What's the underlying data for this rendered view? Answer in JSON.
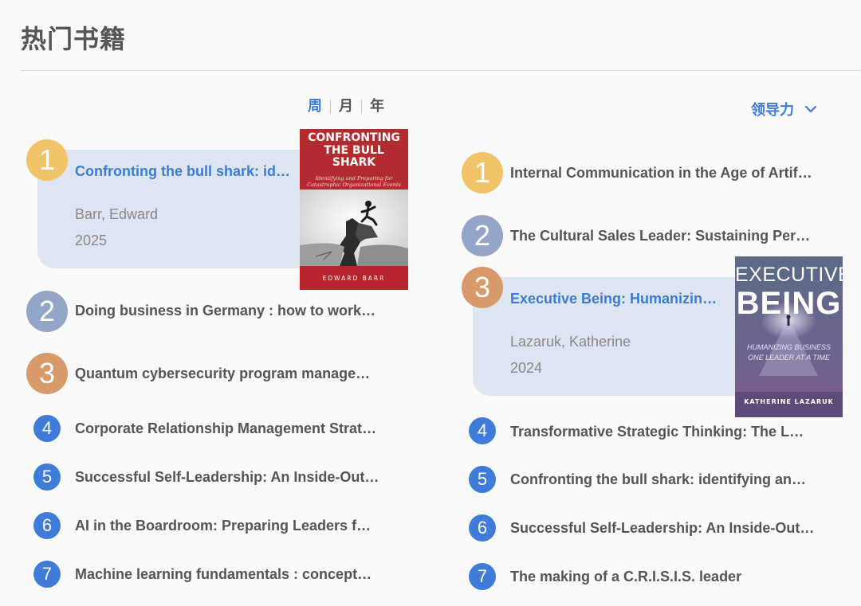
{
  "page": {
    "title": "热门书籍"
  },
  "period_tabs": [
    {
      "label": "周",
      "active": true
    },
    {
      "label": "月",
      "active": false
    },
    {
      "label": "年",
      "active": false
    }
  ],
  "category": {
    "label": "领导力",
    "icon": "chevron-down-icon"
  },
  "colors": {
    "accent": "#3d7bd6",
    "rank_gold": "#f2c46a",
    "rank_silver": "#94a6c7",
    "rank_bronze": "#d89a6a",
    "rank_blue": "#3f7bd8",
    "card_bg": "#dde5f1"
  },
  "left_list": {
    "featured": {
      "rank": "1",
      "title": "Confronting the bull shark: identifying and preparing for catastrophic organizational events",
      "author": "Barr, Edward",
      "year": "2025",
      "cover": {
        "title_line1": "CONFRONTING",
        "title_line2": "THE BULL",
        "title_line3": "SHARK",
        "subtitle_line1": "Identifying and Preparing for",
        "subtitle_line2": "Catastrophic Organizational Events",
        "author": "EDWARD BARR"
      }
    },
    "items": [
      {
        "rank": "2",
        "title": "Doing business in Germany : how to work successfully"
      },
      {
        "rank": "3",
        "title": "Quantum cybersecurity program management"
      },
      {
        "rank": "4",
        "title": "Corporate Relationship Management Strategies"
      },
      {
        "rank": "5",
        "title": "Successful Self-Leadership: An Inside-Out Approach"
      },
      {
        "rank": "6",
        "title": "AI in the Boardroom: Preparing Leaders for the Future"
      },
      {
        "rank": "7",
        "title": "Machine learning fundamentals : concepts and applications"
      }
    ]
  },
  "right_list": {
    "items_top": [
      {
        "rank": "1",
        "title": "Internal Communication in the Age of Artificial Intelligence"
      },
      {
        "rank": "2",
        "title": "The Cultural Sales Leader: Sustaining Performance"
      }
    ],
    "featured": {
      "rank": "3",
      "title": "Executive Being: Humanizing Business One Leader at a Time",
      "author": "Lazaruk, Katherine",
      "year": "2024",
      "cover": {
        "title_line1": "EXECUTIVE",
        "title_line2": "BEING",
        "subtitle_line1": "HUMANIZING BUSINESS",
        "subtitle_line2": "ONE LEADER AT A TIME",
        "author": "KATHERINE LAZARUK"
      }
    },
    "items": [
      {
        "rank": "4",
        "title": "Transformative Strategic Thinking: The Leader's Guide"
      },
      {
        "rank": "5",
        "title": "Confronting the bull shark: identifying and preparing"
      },
      {
        "rank": "6",
        "title": "Successful Self-Leadership: An Inside-Out Approach"
      },
      {
        "rank": "7",
        "title": "The making of a C.R.I.S.I.S. leader"
      }
    ]
  }
}
